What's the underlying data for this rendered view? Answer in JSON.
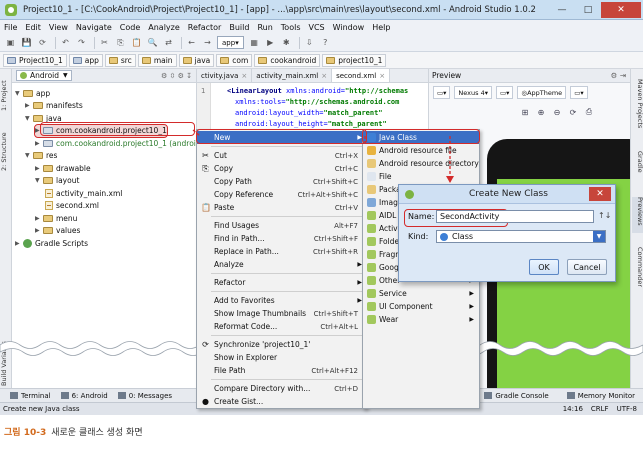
{
  "window": {
    "title": "Project10_1 - [C:\\CookAndroid\\Project\\Project10_1] - [app] - ...\\app\\src\\main\\res\\layout\\second.xml - Android Studio 1.0.2",
    "minimize": "—",
    "maximize": "□",
    "close": "✕"
  },
  "menubar": [
    "File",
    "Edit",
    "View",
    "Navigate",
    "Code",
    "Analyze",
    "Refactor",
    "Build",
    "Run",
    "Tools",
    "VCS",
    "Window",
    "Help"
  ],
  "toolbar": {
    "run_config": "app",
    "icons": [
      "project-icon",
      "save-icon",
      "sync-icon",
      "undo-icon",
      "redo-icon",
      "cut-icon",
      "copy-icon",
      "paste-icon",
      "find-icon",
      "replace-icon",
      "back-icon",
      "forward-icon",
      "build-icon",
      "run-icon",
      "debug-icon",
      "sdk-icon",
      "help-icon"
    ]
  },
  "breadcrumb": [
    "Project10_1",
    "app",
    "src",
    "main",
    "java",
    "com",
    "cookandroid",
    "project10_1"
  ],
  "left_strip": [
    "1: Project",
    "2: Structure",
    "Build Variants",
    "2: Favorites"
  ],
  "project_panel": {
    "view_mode": "Android",
    "tree": [
      {
        "label": "app",
        "level": 0,
        "kind": "module",
        "open": true
      },
      {
        "label": "manifests",
        "level": 1,
        "kind": "folder",
        "open": false
      },
      {
        "label": "java",
        "level": 1,
        "kind": "folder",
        "open": true
      },
      {
        "label": "com.cookandroid.project10_1",
        "level": 2,
        "kind": "package",
        "open": false,
        "selected": true
      },
      {
        "label": "com.cookandroid.project10_1 (androidTest)",
        "level": 2,
        "kind": "package",
        "open": false
      },
      {
        "label": "res",
        "level": 1,
        "kind": "folder",
        "open": true
      },
      {
        "label": "drawable",
        "level": 2,
        "kind": "folder",
        "open": false
      },
      {
        "label": "layout",
        "level": 2,
        "kind": "folder",
        "open": true
      },
      {
        "label": "activity_main.xml",
        "level": 3,
        "kind": "xml"
      },
      {
        "label": "second.xml",
        "level": 3,
        "kind": "xml"
      },
      {
        "label": "menu",
        "level": 2,
        "kind": "folder",
        "open": false
      },
      {
        "label": "values",
        "level": 2,
        "kind": "folder",
        "open": false
      },
      {
        "label": "Gradle Scripts",
        "level": 0,
        "kind": "gradle",
        "open": false
      }
    ]
  },
  "editor": {
    "tabs": [
      {
        "label": "ctivity.java",
        "active": false
      },
      {
        "label": "activity_main.xml",
        "active": false
      },
      {
        "label": "second.xml",
        "active": true
      }
    ],
    "lines": [
      {
        "num": "1",
        "tag": "<LinearLayout ",
        "attr": "xmlns:android=",
        "val": "\"http://schemas"
      },
      {
        "num": "",
        "tag": "",
        "attr": "xmlns:tools=",
        "val": "\"http://schemas.android.com"
      },
      {
        "num": "",
        "tag": "",
        "attr": "android:layout_width=",
        "val": "\"match_parent\""
      },
      {
        "num": "",
        "tag": "",
        "attr": "android:layout_height=",
        "val": "\"match_parent\""
      }
    ]
  },
  "preview": {
    "label": "Preview",
    "device": "Nexus 4",
    "theme": "AppTheme",
    "zoom_icons": [
      "zoom-fit-icon",
      "zoom-in-icon",
      "zoom-out-icon",
      "refresh-icon",
      "screenshot-icon"
    ]
  },
  "right_strip": [
    "Maven Projects",
    "Gradle",
    "Previews",
    "Commander"
  ],
  "context_menu": {
    "items": [
      {
        "label": "New",
        "shortcut": "",
        "submenu": true,
        "highlight": true
      },
      {
        "sep": true
      },
      {
        "label": "Cut",
        "shortcut": "Ctrl+X",
        "icon": "cut-icon"
      },
      {
        "label": "Copy",
        "shortcut": "Ctrl+C",
        "icon": "copy-icon"
      },
      {
        "label": "Copy Path",
        "shortcut": "Ctrl+Shift+C"
      },
      {
        "label": "Copy Reference",
        "shortcut": "Ctrl+Alt+Shift+C"
      },
      {
        "label": "Paste",
        "shortcut": "Ctrl+V",
        "icon": "paste-icon"
      },
      {
        "sep": true
      },
      {
        "label": "Find Usages",
        "shortcut": "Alt+F7"
      },
      {
        "label": "Find in Path...",
        "shortcut": "Ctrl+Shift+F"
      },
      {
        "label": "Replace in Path...",
        "shortcut": "Ctrl+Shift+R"
      },
      {
        "label": "Analyze",
        "shortcut": "",
        "submenu": true
      },
      {
        "sep": true
      },
      {
        "label": "Refactor",
        "shortcut": "",
        "submenu": true
      },
      {
        "sep": true
      },
      {
        "label": "Add to Favorites",
        "shortcut": "",
        "submenu": true
      },
      {
        "label": "Show Image Thumbnails",
        "shortcut": "Ctrl+Shift+T"
      },
      {
        "label": "Reformat Code...",
        "shortcut": "Ctrl+Alt+L"
      },
      {
        "sep": true
      },
      {
        "label": "Synchronize 'project10_1'",
        "shortcut": "",
        "icon": "sync-icon"
      },
      {
        "label": "Show in Explorer",
        "shortcut": ""
      },
      {
        "label": "File Path",
        "shortcut": "Ctrl+Alt+F12"
      },
      {
        "sep": true
      },
      {
        "label": "Compare Directory with...",
        "shortcut": "Ctrl+D"
      },
      {
        "label": "Create Gist...",
        "shortcut": "",
        "icon": "github-icon"
      }
    ]
  },
  "submenu": {
    "items": [
      {
        "label": "Java Class",
        "highlight": true,
        "color": "#3d7fd6"
      },
      {
        "label": "Android resource file",
        "color": "#e8b33f"
      },
      {
        "label": "Android resource directory",
        "color": "#e8c878"
      },
      {
        "label": "File",
        "color": "#dfe6ef"
      },
      {
        "label": "Package",
        "color": "#e8c878"
      },
      {
        "label": "Image Asset",
        "color": "#7fa8d8"
      },
      {
        "label": "AIDL",
        "color": "#a2c85d",
        "submenu": true
      },
      {
        "label": "Activity",
        "color": "#a2c85d",
        "submenu": true
      },
      {
        "label": "Folder",
        "color": "#a2c85d",
        "submenu": true
      },
      {
        "label": "Fragment",
        "color": "#a2c85d",
        "submenu": true
      },
      {
        "label": "Google",
        "color": "#a2c85d",
        "submenu": true
      },
      {
        "label": "Other",
        "color": "#a2c85d",
        "submenu": true
      },
      {
        "label": "Service",
        "color": "#a2c85d",
        "submenu": true
      },
      {
        "label": "UI Component",
        "color": "#a2c85d",
        "submenu": true
      },
      {
        "label": "Wear",
        "color": "#a2c85d",
        "submenu": true
      }
    ]
  },
  "dialog": {
    "title": "Create New Class",
    "name_label": "Name:",
    "name_value": "SecondActivity",
    "kind_label": "Kind:",
    "kind_value": "Class",
    "ok": "OK",
    "cancel": "Cancel",
    "sort_icon": "↑↓"
  },
  "bottom_tools": [
    {
      "label": "Terminal"
    },
    {
      "label": "6: Android"
    },
    {
      "label": "0: Messages"
    }
  ],
  "bottom_tools_right": [
    {
      "label": "Event Log"
    },
    {
      "label": "Gradle Console"
    },
    {
      "label": "Memory Monitor"
    }
  ],
  "status": {
    "message": "Create new Java class",
    "position": "14:16",
    "line_sep": "CRLF",
    "encoding": "UTF-8"
  },
  "caption": {
    "number": "그림 10-3",
    "text": "새로운 클래스 생성 화면"
  },
  "accent": {
    "highlight": "#3b6fc5",
    "callout": "#d32b2b",
    "phone_screen": "#84d244"
  }
}
